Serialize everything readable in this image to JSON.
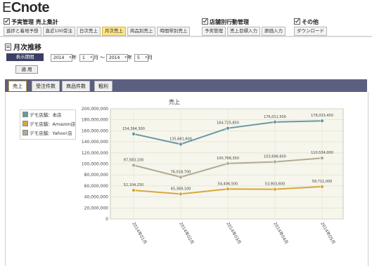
{
  "app": {
    "logo_prefix": "E",
    "logo_rest": "Cnote"
  },
  "menu": {
    "groups": [
      {
        "title": "予実管理 売上集計",
        "tabs": [
          "進捗と着地予想",
          "直近100受注",
          "日次売上",
          "月次売上",
          "商品別売上",
          "時間帯別売上"
        ]
      },
      {
        "title": "店舗別行動管理",
        "tabs": [
          "予実管理",
          "売上目標入力",
          "原価入力"
        ]
      },
      {
        "title": "その他",
        "tabs": [
          "ダウンロード"
        ]
      }
    ],
    "active_tab": "月次売上"
  },
  "page": {
    "title": "月次推移"
  },
  "filter": {
    "period_label": "表示期間",
    "start_year": "2014",
    "start_month": "1",
    "end_year": "2014",
    "end_month": "5",
    "year_unit": "年",
    "month_unit": "月",
    "range_sep": "～",
    "apply_label": "適 用"
  },
  "chart_tabs": [
    "売上",
    "受注件数",
    "商品件数",
    "粗利"
  ],
  "active_chart_tab": "売上",
  "chart_data": {
    "type": "line",
    "title": "売上",
    "xlabel": "",
    "ylabel": "",
    "categories": [
      "2014年01月",
      "2014年02月",
      "2014年03月",
      "2014年04月",
      "2014年05月"
    ],
    "ylim": [
      0,
      200000000
    ],
    "yticks": [
      "0",
      "20,000,000",
      "40,000,000",
      "60,000,000",
      "80,000,000",
      "100,000,000",
      "120,000,000",
      "140,000,000",
      "160,000,000",
      "180,000,000",
      "200,000,000"
    ],
    "legend_position": "top-left",
    "grid": true,
    "series": [
      {
        "name": "デモ店舗：本店",
        "color": "#6a98a4",
        "values": [
          154394300,
          135681600,
          164725850,
          176011500,
          178033450
        ],
        "labels": [
          "154,394,300",
          "135,681,600",
          "164,725,850",
          "176,011,500",
          "178,033,450"
        ]
      },
      {
        "name": "デモ店舗：Amazon店",
        "color": "#d9a63c",
        "values": [
          52104250,
          45369100,
          54406500,
          53903600,
          58711000
        ],
        "labels": [
          "52,104,250",
          "45,369,100",
          "54,406,500",
          "53,903,600",
          "58,711,000"
        ]
      },
      {
        "name": "デモ店舗：Yahoo!店",
        "color": "#b3aa93",
        "values": [
          97583100,
          76018700,
          100768350,
          103696600,
          110534000
        ],
        "labels": [
          "97,583,100",
          "76,018,700",
          "100,768,350",
          "103,696,600",
          "110,534,000"
        ]
      }
    ]
  }
}
